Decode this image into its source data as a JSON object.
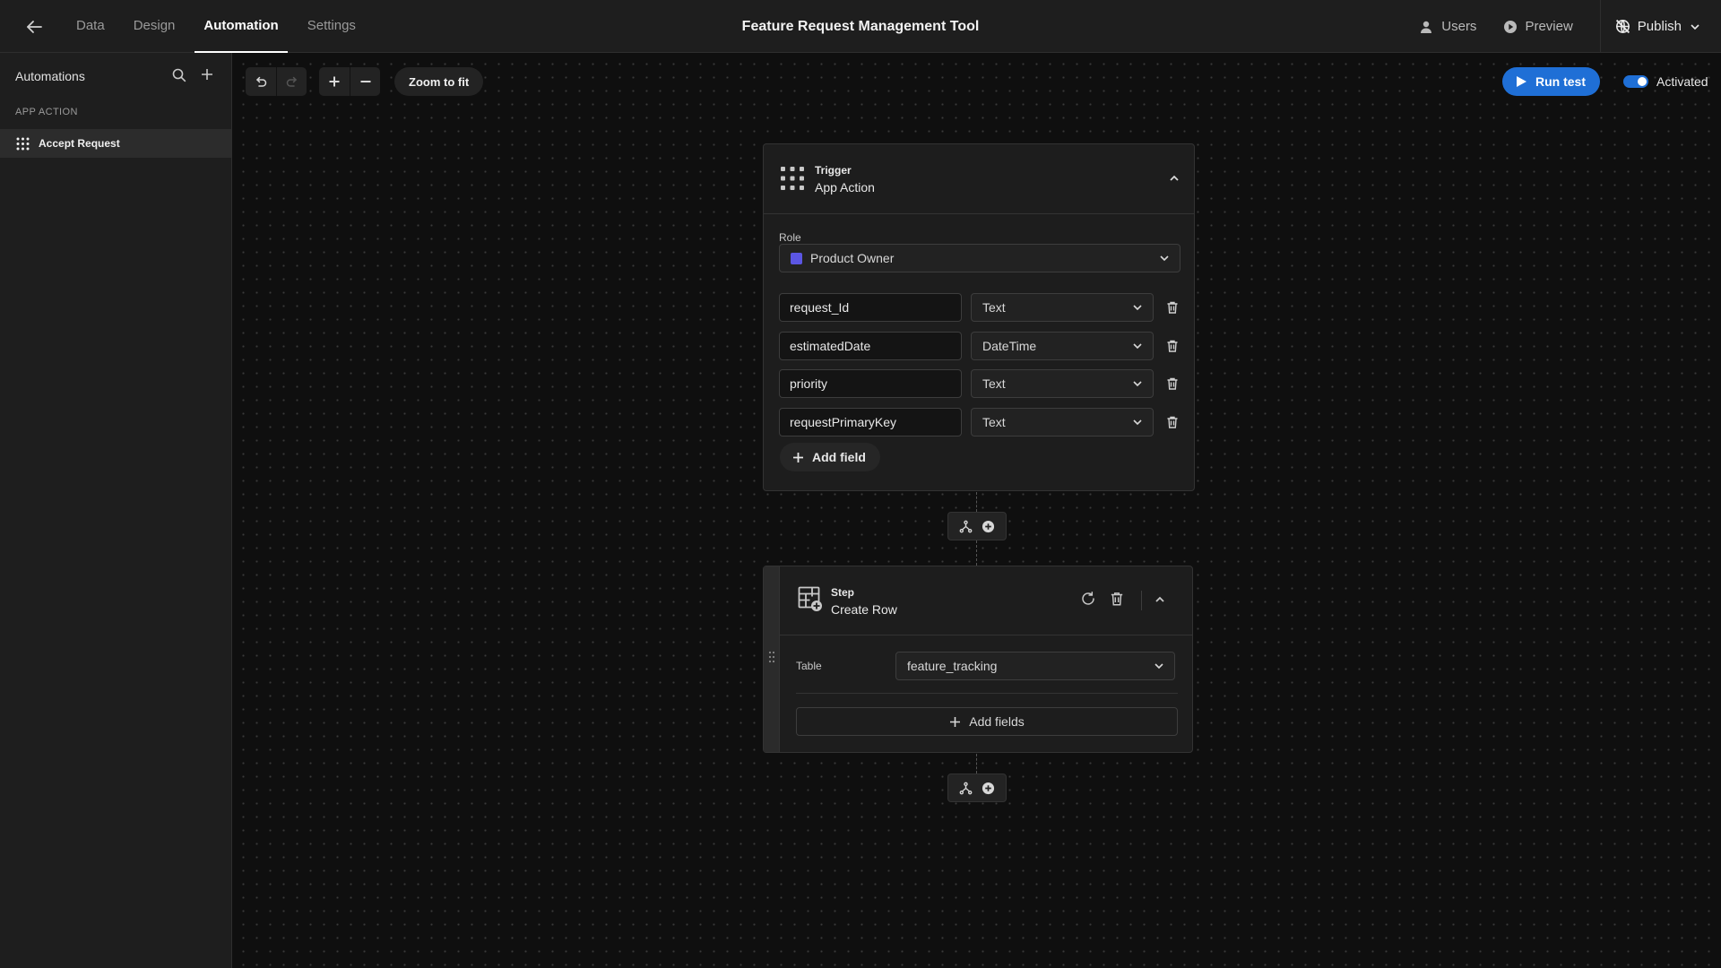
{
  "header": {
    "nav_tabs": [
      {
        "label": "Data",
        "active": false
      },
      {
        "label": "Design",
        "active": false
      },
      {
        "label": "Automation",
        "active": true
      },
      {
        "label": "Settings",
        "active": false
      }
    ],
    "app_title": "Feature Request Management Tool",
    "users_label": "Users",
    "preview_label": "Preview",
    "publish_label": "Publish"
  },
  "sidebar": {
    "title": "Automations",
    "section_label": "APP ACTION",
    "items": [
      {
        "label": "Accept Request",
        "selected": true
      }
    ]
  },
  "toolbar": {
    "zoom_to_fit_label": "Zoom to fit",
    "run_test_label": "Run test",
    "activated_label": "Activated",
    "activated": true
  },
  "trigger": {
    "kicker": "Trigger",
    "title": "App Action",
    "role_label": "Role",
    "role_value": "Product Owner",
    "role_color": "#5b56e3",
    "fields": [
      {
        "name": "request_Id",
        "type": "Text"
      },
      {
        "name": "estimatedDate",
        "type": "DateTime"
      },
      {
        "name": "priority",
        "type": "Text"
      },
      {
        "name": "requestPrimaryKey",
        "type": "Text"
      }
    ],
    "add_field_label": "Add field"
  },
  "step": {
    "kicker": "Step",
    "title": "Create Row",
    "table_label": "Table",
    "table_value": "feature_tracking",
    "add_fields_label": "Add fields"
  },
  "colors": {
    "accent": "#1f6fd6",
    "background": "#0f0f0f",
    "panel": "#1e1e1e"
  }
}
